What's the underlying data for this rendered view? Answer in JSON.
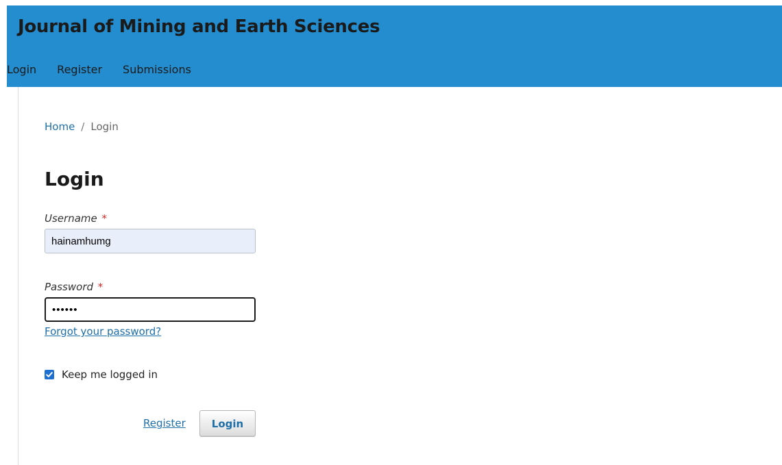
{
  "header": {
    "site_title": "Journal of Mining and Earth Sciences",
    "nav": [
      "Login",
      "Register",
      "Submissions"
    ]
  },
  "breadcrumb": {
    "home": "Home",
    "separator": "/",
    "current": "Login"
  },
  "page": {
    "title": "Login"
  },
  "form": {
    "username_label": "Username",
    "username_value": "hainamhumg",
    "password_label": "Password",
    "password_value": "••••••",
    "required_marker": "*",
    "forgot_password": "Forgot your password?",
    "remember_label": "Keep me logged in",
    "remember_checked": true,
    "register_link": "Register",
    "login_button": "Login"
  },
  "colors": {
    "header_bg": "#238dcf",
    "link": "#1e6fa8",
    "required": "#d02929",
    "checkbox": "#1d6fd2"
  }
}
